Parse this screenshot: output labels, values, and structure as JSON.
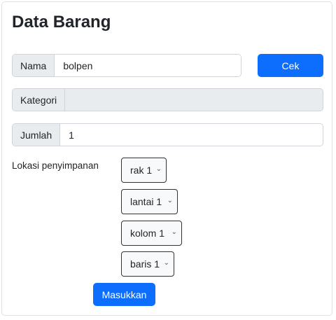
{
  "title": "Data Barang",
  "form": {
    "nama": {
      "label": "Nama",
      "value": "bolpen"
    },
    "cek_label": "Cek",
    "kategori": {
      "label": "Kategori",
      "value": ""
    },
    "jumlah": {
      "label": "Jumlah",
      "value": "1"
    },
    "lokasi_label": "Lokasi penyimpanan",
    "selects": {
      "rak": "rak 1",
      "lantai": "lantai 1",
      "kolom": "kolom 1",
      "baris": "baris 1"
    },
    "submit_label": "Masukkan"
  },
  "colors": {
    "primary": "#0d6efd"
  }
}
